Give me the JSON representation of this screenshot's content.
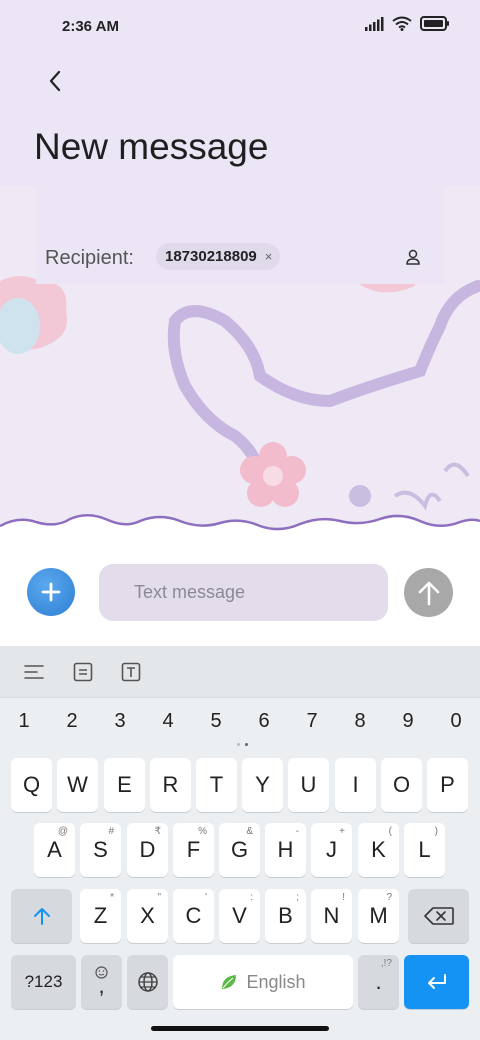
{
  "status_bar": {
    "time": "2:36 AM",
    "icons": [
      "signal-icon",
      "wifi-icon",
      "battery-icon"
    ]
  },
  "header": {
    "back_icon": "back-arrow-icon",
    "title": "New message"
  },
  "recipient": {
    "label": "Recipient:",
    "chip_value": "18730218809",
    "chip_remove": "×",
    "contact_icon": "contact-person-icon"
  },
  "compose": {
    "add_icon": "plus-icon",
    "placeholder": "Text message",
    "send_icon": "send-arrow-icon"
  },
  "keyboard": {
    "toolbar_icons": [
      "text-align-icon",
      "clipboard-icon",
      "text-format-icon"
    ],
    "numbers": [
      "1",
      "2",
      "3",
      "4",
      "5",
      "6",
      "7",
      "8",
      "9",
      "0"
    ],
    "row1": [
      {
        "key": "Q",
        "hint": ""
      },
      {
        "key": "W",
        "hint": ""
      },
      {
        "key": "E",
        "hint": ""
      },
      {
        "key": "R",
        "hint": ""
      },
      {
        "key": "T",
        "hint": ""
      },
      {
        "key": "Y",
        "hint": ""
      },
      {
        "key": "U",
        "hint": ""
      },
      {
        "key": "I",
        "hint": ""
      },
      {
        "key": "O",
        "hint": ""
      },
      {
        "key": "P",
        "hint": ""
      }
    ],
    "row2": [
      {
        "key": "A",
        "hint": "@"
      },
      {
        "key": "S",
        "hint": "#"
      },
      {
        "key": "D",
        "hint": "₹"
      },
      {
        "key": "F",
        "hint": "%"
      },
      {
        "key": "G",
        "hint": "&"
      },
      {
        "key": "H",
        "hint": "-"
      },
      {
        "key": "J",
        "hint": "+"
      },
      {
        "key": "K",
        "hint": "("
      },
      {
        "key": "L",
        "hint": ")"
      }
    ],
    "row3": [
      {
        "key": "Z",
        "hint": "*"
      },
      {
        "key": "X",
        "hint": "\""
      },
      {
        "key": "C",
        "hint": "'"
      },
      {
        "key": "V",
        "hint": ":"
      },
      {
        "key": "B",
        "hint": ";"
      },
      {
        "key": "N",
        "hint": "!"
      },
      {
        "key": "M",
        "hint": "?"
      }
    ],
    "symbols_label": "?123",
    "comma_label": ",",
    "space_label": "English",
    "period_label": ".",
    "period_hint": ",!?",
    "accent_color": "#1593f5"
  }
}
